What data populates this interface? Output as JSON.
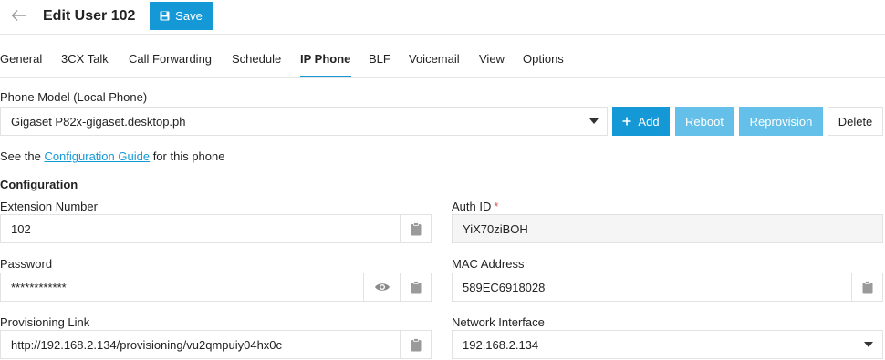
{
  "header": {
    "title": "Edit User 102",
    "save_label": "Save"
  },
  "tabs": [
    {
      "label": "General"
    },
    {
      "label": "3CX Talk"
    },
    {
      "label": "Call Forwarding"
    },
    {
      "label": "Schedule"
    },
    {
      "label": "IP Phone",
      "active": true
    },
    {
      "label": "BLF"
    },
    {
      "label": "Voicemail"
    },
    {
      "label": "View"
    },
    {
      "label": "Options"
    }
  ],
  "phone": {
    "model_label": "Phone Model (Local Phone)",
    "model_value": "Gigaset P82x-gigaset.desktop.ph",
    "add_label": "Add",
    "reboot_label": "Reboot",
    "reprovision_label": "Reprovision",
    "delete_label": "Delete",
    "guide_prefix": "See the ",
    "guide_link": "Configuration Guide",
    "guide_suffix": " for this phone"
  },
  "config": {
    "section_title": "Configuration",
    "extension_label": "Extension Number",
    "extension_value": "102",
    "auth_id_label": "Auth ID",
    "auth_id_required": "*",
    "auth_id_value": "YiX70ziBOH",
    "password_label": "Password",
    "password_value": "************",
    "mac_label": "MAC Address",
    "mac_value": "589EC6918028",
    "prov_link_label": "Provisioning Link",
    "prov_link_value": "http://192.168.2.134/provisioning/vu2qmpuiy04hx0c",
    "network_label": "Network Interface",
    "network_value": "192.168.2.134"
  },
  "colors": {
    "accent": "#1599d6",
    "accent_disabled": "#64c0e8",
    "required": "#d9534f"
  },
  "icons": [
    "arrow-left-icon",
    "save-icon",
    "plus-icon",
    "chevron-down-icon",
    "clipboard-icon",
    "eye-icon"
  ]
}
